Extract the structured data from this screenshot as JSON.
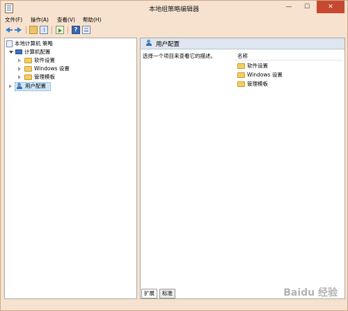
{
  "window": {
    "title": "本地组策略编辑器"
  },
  "menu": [
    "文件(F)",
    "操作(A)",
    "查看(V)",
    "帮助(H)"
  ],
  "toolbar": {
    "icons": [
      "back-arrow-icon",
      "forward-arrow-icon",
      "up-folder-icon",
      "show-tree-icon",
      "export-list-icon",
      "help-icon",
      "properties-icon"
    ]
  },
  "tree": {
    "root": "本地计算机 策略",
    "computer": "计算机配置",
    "children": [
      "软件设置",
      "Windows 设置",
      "管理模板"
    ],
    "user": "用户配置"
  },
  "content": {
    "header": "用户配置",
    "description": "选择一个项目来查看它的描述。",
    "column_name": "名称",
    "items": [
      "软件设置",
      "Windows 设置",
      "管理模板"
    ]
  },
  "tabs": [
    "扩展",
    "标准"
  ],
  "watermark": "Baidu 经验"
}
